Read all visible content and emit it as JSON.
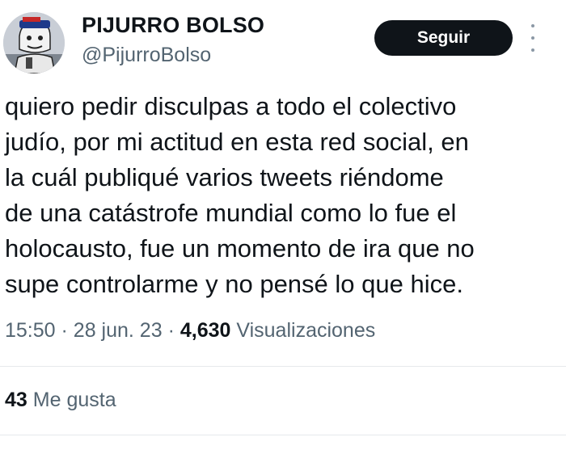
{
  "author": {
    "display_name": "PIJURRO BOLSO",
    "handle": "@PijurroBolso",
    "avatar_icon": "cartoon-avatar"
  },
  "actions": {
    "follow_label": "Seguir",
    "more_icon": "more-vertical-icon"
  },
  "tweet": {
    "lines": [
      "quiero pedir disculpas a todo el colectivo",
      "judío, por mi actitud en esta red social, en",
      "la cuál publiqué varios tweets riéndome",
      "de una catástrofe mundial como lo fue el",
      "holocausto, fue un momento de ira que no",
      "supe controlarme y no pensé lo que hice."
    ]
  },
  "meta": {
    "time": "15:50",
    "separator": "·",
    "date": "28 jun. 23",
    "views_count": "4,630",
    "views_label": "Visualizaciones"
  },
  "stats": {
    "likes_count": "43",
    "likes_label": "Me gusta"
  }
}
